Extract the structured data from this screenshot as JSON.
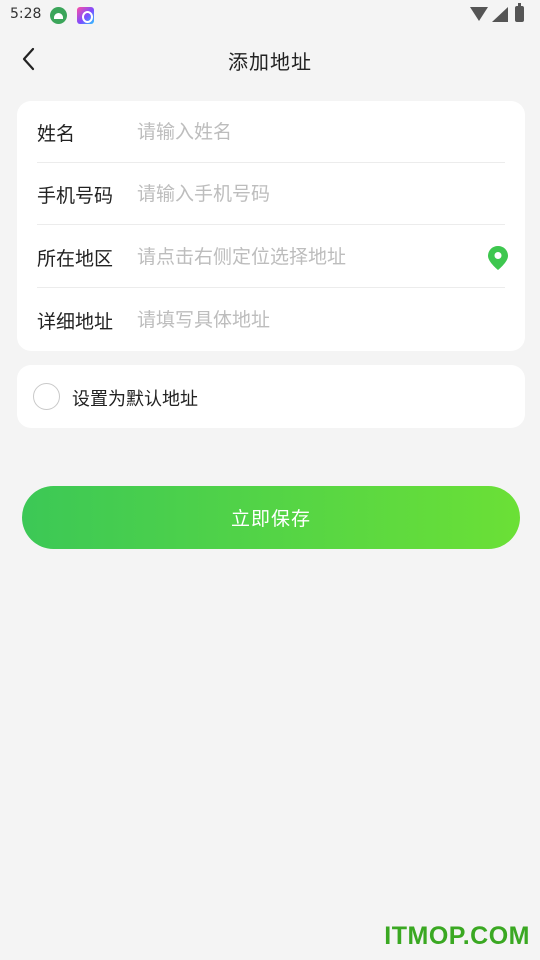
{
  "status_bar": {
    "time": "5:28",
    "icons": [
      "android-icon",
      "gallery-icon",
      "wifi-icon",
      "signal-icon",
      "battery-icon"
    ]
  },
  "header": {
    "title": "添加地址",
    "back_icon": "chevron-left-icon"
  },
  "form": {
    "fields": [
      {
        "label": "姓名",
        "value": "",
        "placeholder": "请输入姓名"
      },
      {
        "label": "手机号码",
        "value": "",
        "placeholder": "请输入手机号码"
      },
      {
        "label": "所在地区",
        "value": "",
        "placeholder": "请点击右侧定位选择地址",
        "icon": "map-pin-icon"
      },
      {
        "label": "详细地址",
        "value": "",
        "placeholder": "请填写具体地址"
      }
    ]
  },
  "default_address": {
    "label": "设置为默认地址",
    "checked": false
  },
  "save_button": {
    "label": "立即保存"
  },
  "watermark": "ITMOP.COM",
  "colors": {
    "accent_start": "#3cc856",
    "accent_end": "#6be036",
    "background": "#f4f4f4",
    "card": "#ffffff",
    "placeholder": "#bdbdbd"
  }
}
